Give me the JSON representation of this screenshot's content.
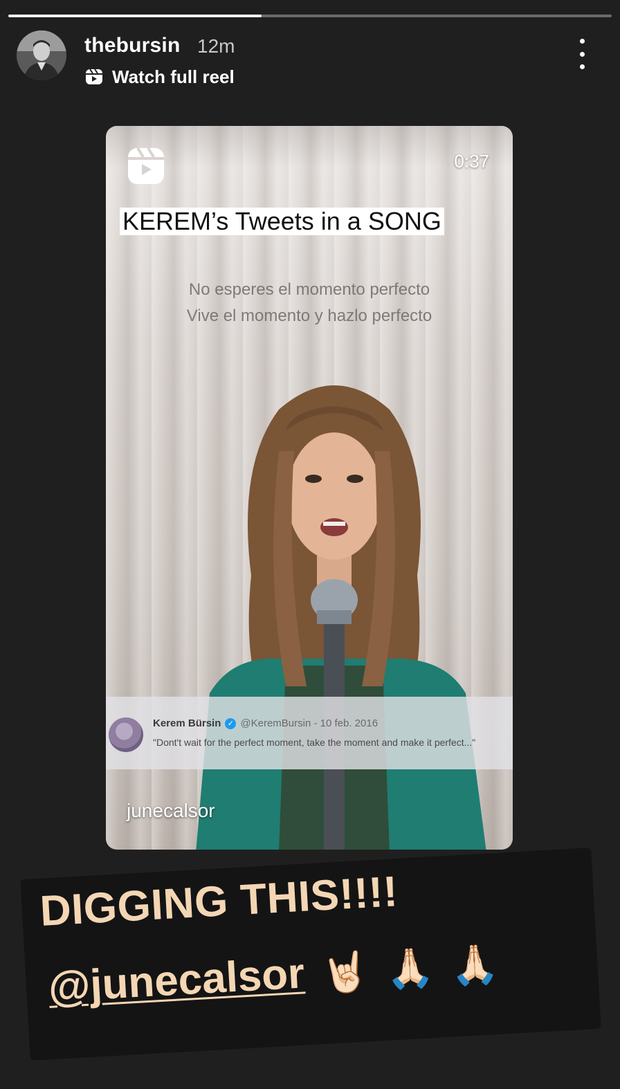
{
  "story": {
    "progress": 0.42,
    "username": "thebursin",
    "time_ago": "12m",
    "reel_link_label": "Watch full reel",
    "more_icon": "more-vertical-icon"
  },
  "reel": {
    "duration": "0:37",
    "title": "KEREM’s Tweets in a SONG",
    "lyrics": [
      "No esperes el momento perfecto",
      "Vive el momento y hazlo perfecto"
    ],
    "tweet": {
      "name": "Kerem Bürsin",
      "handle_date": "@KeremBursin - 10 feb. 2016",
      "text": "\"Dont't wait for the perfect moment, take the moment and make it perfect...\""
    },
    "author": "junecalsor"
  },
  "caption": {
    "line1": "DIGGING THIS!!!!",
    "mention": "@junecalsor",
    "emojis": [
      "🤘🏻",
      "🙏🏻",
      "🙏🏻"
    ]
  },
  "colors": {
    "background": "#201f1f",
    "caption_text": "#f4d6b4",
    "caption_bg": "#141414"
  }
}
